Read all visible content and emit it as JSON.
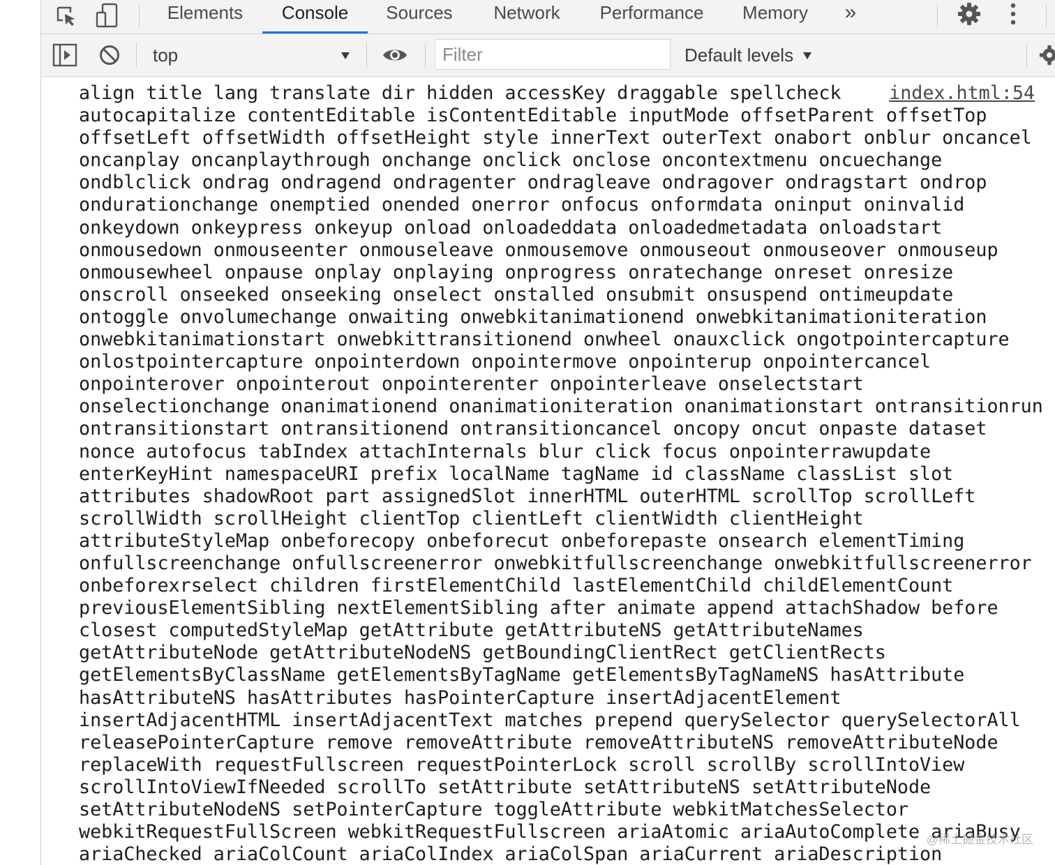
{
  "devtools": {
    "tabs": [
      {
        "label": "Elements"
      },
      {
        "label": "Console"
      },
      {
        "label": "Sources"
      },
      {
        "label": "Network"
      },
      {
        "label": "Performance"
      },
      {
        "label": "Memory"
      }
    ],
    "more_tabs_label": "»",
    "active_tab": "Console",
    "accent_color": "#1a73e8",
    "icons": [
      "inspect-element-icon",
      "device-toolbar-icon",
      "gear-icon",
      "kebab-menu-icon",
      "sidebar-toggle-icon",
      "clear-console-icon",
      "eye-icon"
    ]
  },
  "toolbar": {
    "context": "top",
    "filter_placeholder": "Filter",
    "levels": "Default levels"
  },
  "console": {
    "source": "index.html:54",
    "lines": [
      "align title lang translate dir hidden accessKey draggable spellcheck",
      "autocapitalize contentEditable isContentEditable inputMode offsetParent offsetTop",
      "offsetLeft offsetWidth offsetHeight style innerText outerText onabort onblur oncancel",
      "oncanplay oncanplaythrough onchange onclick onclose oncontextmenu oncuechange",
      "ondblclick ondrag ondragend ondragenter ondragleave ondragover ondragstart ondrop",
      "ondurationchange onemptied onended onerror onfocus onformdata oninput oninvalid",
      "onkeydown onkeypress onkeyup onload onloadeddata onloadedmetadata onloadstart",
      "onmousedown onmouseenter onmouseleave onmousemove onmouseout onmouseover onmouseup",
      "onmousewheel onpause onplay onplaying onprogress onratechange onreset onresize",
      "onscroll onseeked onseeking onselect onstalled onsubmit onsuspend ontimeupdate",
      "ontoggle onvolumechange onwaiting onwebkitanimationend onwebkitanimationiteration",
      "onwebkitanimationstart onwebkittransitionend onwheel onauxclick ongotpointercapture",
      "onlostpointercapture onpointerdown onpointermove onpointerup onpointercancel",
      "onpointerover onpointerout onpointerenter onpointerleave onselectstart",
      "onselectionchange onanimationend onanimationiteration onanimationstart ontransitionrun",
      "ontransitionstart ontransitionend ontransitioncancel oncopy oncut onpaste dataset",
      "nonce autofocus tabIndex attachInternals blur click focus onpointerrawupdate",
      "enterKeyHint namespaceURI prefix localName tagName id className classList slot",
      "attributes shadowRoot part assignedSlot innerHTML outerHTML scrollTop scrollLeft",
      "scrollWidth scrollHeight clientTop clientLeft clientWidth clientHeight",
      "attributeStyleMap onbeforecopy onbeforecut onbeforepaste onsearch elementTiming",
      "onfullscreenchange onfullscreenerror onwebkitfullscreenchange onwebkitfullscreenerror",
      "onbeforexrselect children firstElementChild lastElementChild childElementCount",
      "previousElementSibling nextElementSibling after animate append attachShadow before",
      "closest computedStyleMap getAttribute getAttributeNS getAttributeNames",
      "getAttributeNode getAttributeNodeNS getBoundingClientRect getClientRects",
      "getElementsByClassName getElementsByTagName getElementsByTagNameNS hasAttribute",
      "hasAttributeNS hasAttributes hasPointerCapture insertAdjacentElement",
      "insertAdjacentHTML insertAdjacentText matches prepend querySelector querySelectorAll",
      "releasePointerCapture remove removeAttribute removeAttributeNS removeAttributeNode",
      "replaceWith requestFullscreen requestPointerLock scroll scrollBy scrollIntoView",
      "scrollIntoViewIfNeeded scrollTo setAttribute setAttributeNS setAttributeNode",
      "setAttributeNodeNS setPointerCapture toggleAttribute webkitMatchesSelector",
      "webkitRequestFullScreen webkitRequestFullscreen ariaAtomic ariaAutoComplete ariaBusy",
      "ariaChecked ariaColCount ariaColIndex ariaColSpan ariaCurrent ariaDescription"
    ],
    "watermark": "@稀土掘金技术社区"
  }
}
